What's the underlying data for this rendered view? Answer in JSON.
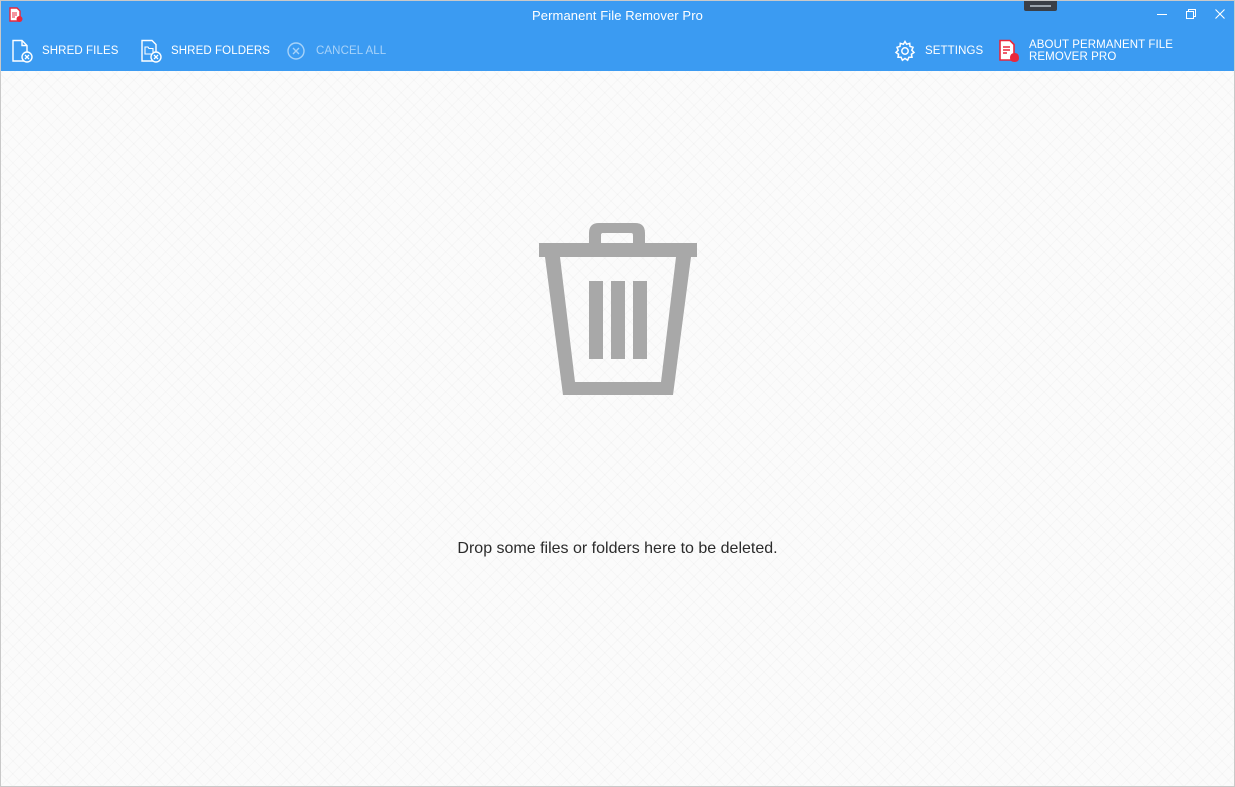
{
  "window": {
    "title": "Permanent File Remover Pro",
    "controls": [
      "minimize-icon",
      "restore-icon",
      "close-icon"
    ]
  },
  "toolbar": {
    "shred_files_label": "SHRED FILES",
    "shred_folders_label": "SHRED FOLDERS",
    "cancel_all_label": "CANCEL ALL",
    "settings_label": "SETTINGS",
    "about_label": "ABOUT PERMANENT FILE REMOVER PRO",
    "icons": {
      "shred_files": "shred-file-icon",
      "shred_folders": "shred-folder-icon",
      "cancel_all": "cancel-circle-icon",
      "settings": "gear-icon",
      "about": "app-logo-icon"
    }
  },
  "main": {
    "drop_hint": "Drop some files or folders here to be deleted.",
    "icon": "trash-icon"
  },
  "colors": {
    "header_bg": "#3b9bf2",
    "accent_red": "#e8283c",
    "trash_gray": "#a8a8a8",
    "disabled_text": "#9fcdf7"
  }
}
